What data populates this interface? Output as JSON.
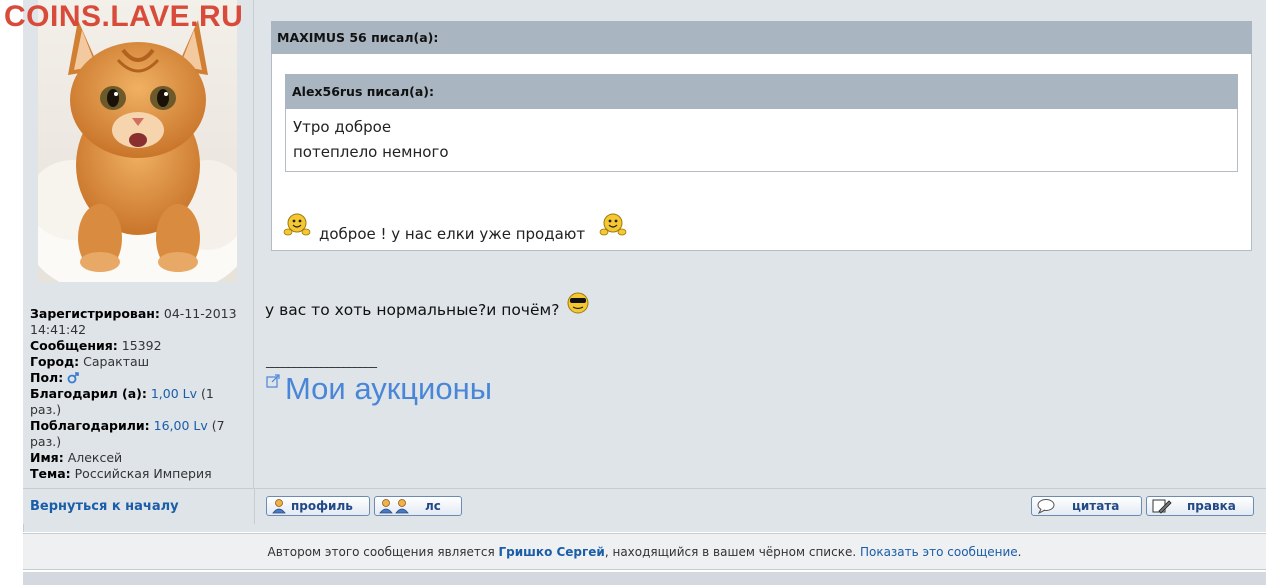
{
  "watermark": "COINS.LAVE.RU",
  "profile": {
    "registered_label": "Зарегистрирован:",
    "registered_value": "04-11-2013 14:41:42",
    "messages_label": "Сообщения:",
    "messages_value": "15392",
    "city_label": "Город:",
    "city_value": "Саракташ",
    "gender_label": "Пол:",
    "thanked_label": "Благодарил (а):",
    "thanked_value": "1,00 Lv",
    "thanked_times": "(1 раз.)",
    "received_label": "Поблагодарили:",
    "received_value": "16,00 Lv",
    "received_times": "(7 раз.)",
    "name_label": "Имя:",
    "name_value": "Алексей",
    "theme_label": "Тема:",
    "theme_value": "Российская Империя"
  },
  "quote_outer": {
    "header": "MAXIMUS 56 писал(а):",
    "text": "доброе ! у нас елки уже продают"
  },
  "quote_inner": {
    "header": "Alex56rus писал(а):",
    "line1": "Утро доброе",
    "line2": "потеплело немного"
  },
  "message": "у вас то хоть нормальные?и почём?",
  "signature": {
    "line": "____________________",
    "link": "Мои аукционы"
  },
  "actions": {
    "back": "Вернуться к началу",
    "profile": "профиль",
    "pm": "лс",
    "quote": "цитата",
    "edit": "правка"
  },
  "notice": {
    "before": "Автором этого сообщения является ",
    "author": "Гришко Сергей",
    "middle": ", находящийся в вашем чёрном списке. ",
    "show": "Показать это сообщение",
    "end": "."
  },
  "colors": {
    "link": "#1a5da8",
    "quote_header": "#a9b5c0",
    "panel": "#dfe4e8",
    "auction_link": "#4a86d8"
  }
}
